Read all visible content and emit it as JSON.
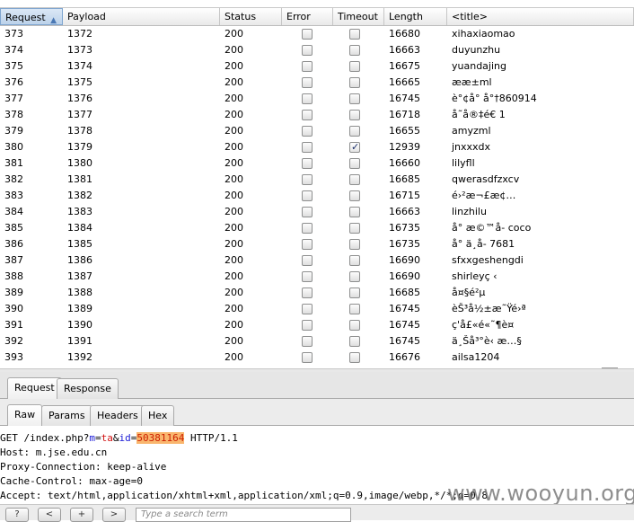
{
  "table": {
    "columns": [
      {
        "label": "Request",
        "sorted": true
      },
      {
        "label": "Payload"
      },
      {
        "label": "Status"
      },
      {
        "label": "Error"
      },
      {
        "label": "Timeout"
      },
      {
        "label": "Length"
      },
      {
        "label": "<title>"
      }
    ],
    "rows": [
      {
        "request": "373",
        "payload": "1372",
        "status": "200",
        "error": false,
        "timeout": false,
        "length": "16680",
        "title": "xihaxiaomao"
      },
      {
        "request": "374",
        "payload": "1373",
        "status": "200",
        "error": false,
        "timeout": false,
        "length": "16663",
        "title": "duyunzhu"
      },
      {
        "request": "375",
        "payload": "1374",
        "status": "200",
        "error": false,
        "timeout": false,
        "length": "16675",
        "title": "yuandajing"
      },
      {
        "request": "376",
        "payload": "1375",
        "status": "200",
        "error": false,
        "timeout": false,
        "length": "16665",
        "title": "ææ±ml"
      },
      {
        "request": "377",
        "payload": "1376",
        "status": "200",
        "error": false,
        "timeout": false,
        "length": "16745",
        "title": "è°¢å° å°†860914"
      },
      {
        "request": "378",
        "payload": "1377",
        "status": "200",
        "error": false,
        "timeout": false,
        "length": "16718",
        "title": "å˜å®‡é€ 1"
      },
      {
        "request": "379",
        "payload": "1378",
        "status": "200",
        "error": false,
        "timeout": false,
        "length": "16655",
        "title": "amyzml"
      },
      {
        "request": "380",
        "payload": "1379",
        "status": "200",
        "error": false,
        "timeout": true,
        "length": "12939",
        "title": "jnxxxdx"
      },
      {
        "request": "381",
        "payload": "1380",
        "status": "200",
        "error": false,
        "timeout": false,
        "length": "16660",
        "title": "lilyfll"
      },
      {
        "request": "382",
        "payload": "1381",
        "status": "200",
        "error": false,
        "timeout": false,
        "length": "16685",
        "title": "qwerasdfzxcv"
      },
      {
        "request": "383",
        "payload": "1382",
        "status": "200",
        "error": false,
        "timeout": false,
        "length": "16715",
        "title": "é›²æ¬£æ¢…"
      },
      {
        "request": "384",
        "payload": "1383",
        "status": "200",
        "error": false,
        "timeout": false,
        "length": "16663",
        "title": "linzhilu"
      },
      {
        "request": "385",
        "payload": "1384",
        "status": "200",
        "error": false,
        "timeout": false,
        "length": "16735",
        "title": "å° æ©™å- coco"
      },
      {
        "request": "386",
        "payload": "1385",
        "status": "200",
        "error": false,
        "timeout": false,
        "length": "16735",
        "title": "å° ä¸å- 7681"
      },
      {
        "request": "387",
        "payload": "1386",
        "status": "200",
        "error": false,
        "timeout": false,
        "length": "16690",
        "title": "sfxxgeshengdi"
      },
      {
        "request": "388",
        "payload": "1387",
        "status": "200",
        "error": false,
        "timeout": false,
        "length": "16690",
        "title": "shirleyç ‹"
      },
      {
        "request": "389",
        "payload": "1388",
        "status": "200",
        "error": false,
        "timeout": false,
        "length": "16685",
        "title": "å¤§é²µ"
      },
      {
        "request": "390",
        "payload": "1389",
        "status": "200",
        "error": false,
        "timeout": false,
        "length": "16745",
        "title": "èŠ³å½±æ˜Ÿé›ª"
      },
      {
        "request": "391",
        "payload": "1390",
        "status": "200",
        "error": false,
        "timeout": false,
        "length": "16745",
        "title": "ç'å£«é«˜¶è¤"
      },
      {
        "request": "392",
        "payload": "1391",
        "status": "200",
        "error": false,
        "timeout": false,
        "length": "16745",
        "title": "ä¸Šå³°è‹ æ…§"
      },
      {
        "request": "393",
        "payload": "1392",
        "status": "200",
        "error": false,
        "timeout": false,
        "length": "16676",
        "title": "ailsa1204"
      }
    ]
  },
  "tabs": {
    "request": "Request",
    "response": "Response"
  },
  "subtabs": {
    "raw": "Raw",
    "params": "Params",
    "headers": "Headers",
    "hex": "Hex"
  },
  "raw": {
    "line1": {
      "method": "GET /index.php?",
      "p1": "m",
      "eq1": "=",
      "v1": "ta",
      "amp": "&",
      "p2": "id",
      "eq2": "=",
      "v2": "50381164",
      "tail": " HTTP/1.1"
    },
    "line2": "Host: m.jse.edu.cn",
    "line3": "Proxy-Connection: keep-alive",
    "line4": "Cache-Control: max-age=0",
    "line5": "Accept: text/html,application/xhtml+xml,application/xml;q=0.9,image/webp,*/*;q=0.8"
  },
  "watermark": "www.wooyun.org",
  "search": {
    "help_label": "?",
    "prev_label": "<",
    "add_label": "+",
    "next_label": ">",
    "placeholder": "Type a search term"
  }
}
